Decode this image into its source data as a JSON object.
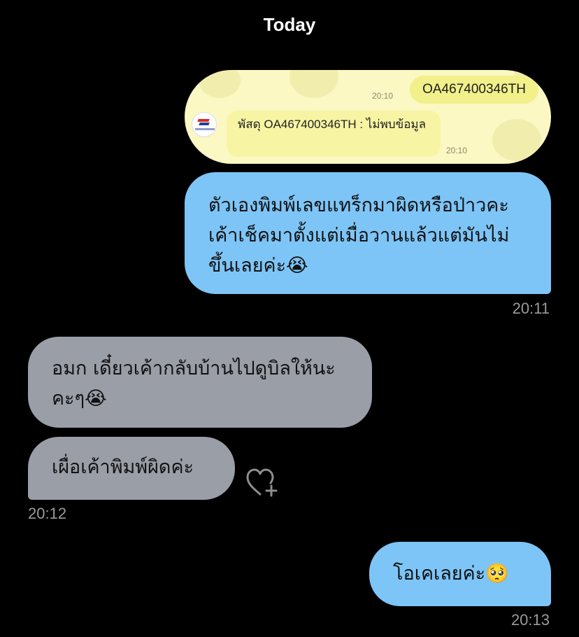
{
  "date_header": "Today",
  "quote": {
    "outgoing_text": "OA467400346TH",
    "outgoing_time": "20:10",
    "incoming_text": "พัสดุ OA467400346TH : ไม่พบข้อมูล",
    "incoming_time": "20:10",
    "logo_icon": "thailand-post-logo"
  },
  "messages": [
    {
      "direction": "out",
      "text": "ตัวเองพิมพ์เลขแทร็กมาผิดหรือป่าวคะ เค้าเช็คมาตั้งแต่เมื่อวานแล้วแต่มันไม่ขึ้นเลยค่ะ😭",
      "time": "20:11"
    },
    {
      "direction": "in",
      "text": "อมก เดี๋ยวเค้ากลับบ้านไปดูบิลให้นะคะๆ😭",
      "time": ""
    },
    {
      "direction": "in",
      "text": "เผื่อเค้าพิมพ์ผิดค่ะ",
      "time": "20:12"
    },
    {
      "direction": "out",
      "text": "โอเคเลยค่ะ🥺",
      "time": "20:13"
    }
  ],
  "reaction_icon": "heart-plus-icon",
  "colors": {
    "background": "#000000",
    "outgoing_bubble": "#7ec5f7",
    "incoming_bubble": "#9a9ea7",
    "quote_card": "#fbf8c4"
  }
}
